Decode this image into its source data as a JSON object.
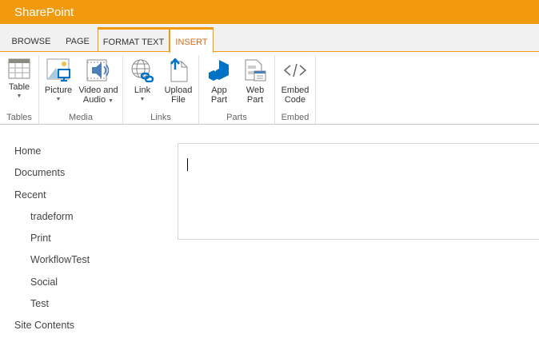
{
  "header": {
    "title": "SharePoint"
  },
  "tabs": [
    "BROWSE",
    "PAGE",
    "FORMAT TEXT",
    "INSERT"
  ],
  "ribbon": {
    "groups": [
      {
        "label": "Tables",
        "buttons": [
          {
            "l1": "Table",
            "l2": ""
          }
        ]
      },
      {
        "label": "Media",
        "buttons": [
          {
            "l1": "Picture",
            "l2": ""
          },
          {
            "l1": "Video and",
            "l2": "Audio"
          }
        ]
      },
      {
        "label": "Links",
        "buttons": [
          {
            "l1": "Link",
            "l2": ""
          },
          {
            "l1": "Upload",
            "l2": "File"
          }
        ]
      },
      {
        "label": "Parts",
        "buttons": [
          {
            "l1": "App",
            "l2": "Part"
          },
          {
            "l1": "Web",
            "l2": "Part"
          }
        ]
      },
      {
        "label": "Embed",
        "buttons": [
          {
            "l1": "Embed",
            "l2": "Code"
          }
        ]
      }
    ]
  },
  "nav": {
    "items": [
      "Home",
      "Documents",
      "Recent"
    ],
    "recent": [
      "tradeform",
      "Print",
      "WorkflowTest",
      "Social",
      "Test"
    ],
    "bottom": "Site Contents"
  },
  "colors": {
    "accent": "#f19a0d",
    "selected_tab": "#d06a1a",
    "icon_blue": "#0072c6"
  }
}
